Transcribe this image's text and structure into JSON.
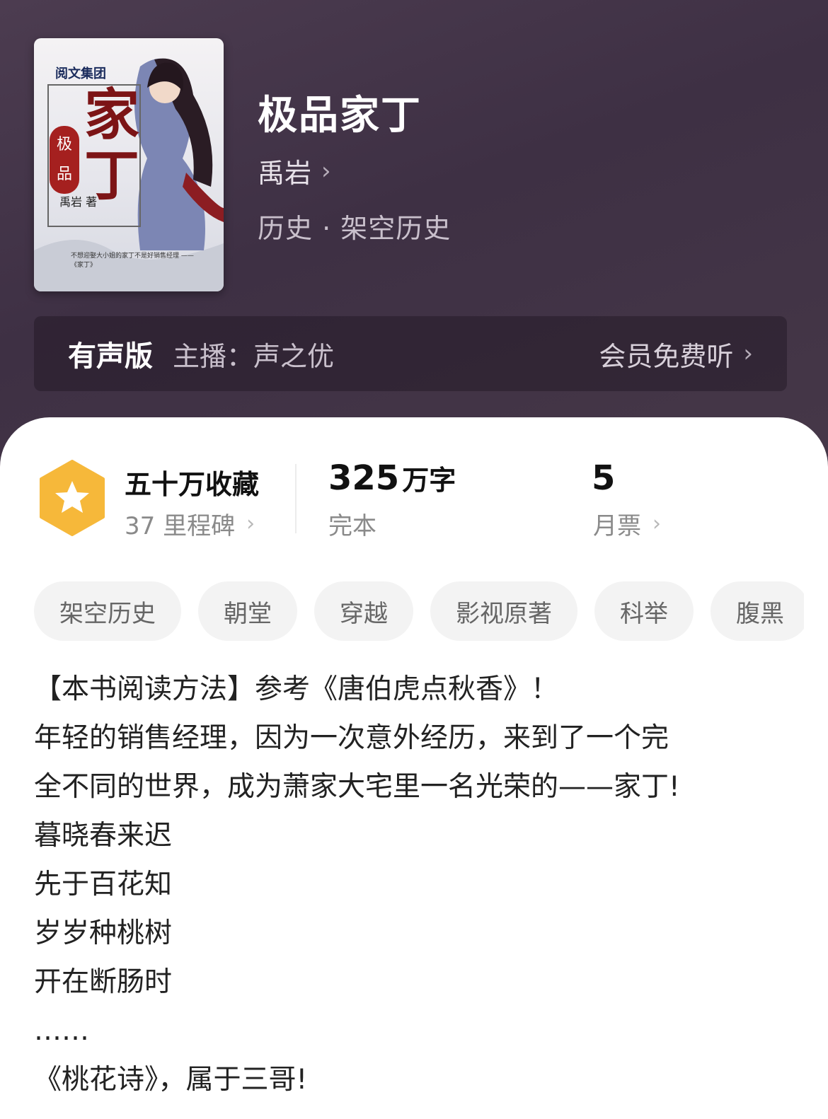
{
  "book": {
    "title": "极品家丁",
    "author": "禹岩",
    "category": "历史 · 架空历史",
    "cover": {
      "publisher": "阅文集团",
      "title": "家丁",
      "badge": "极品",
      "author": "禹岩 著",
      "tagline": "不想迎娶大小姐的家丁不是好销售经理 ——《家丁》"
    }
  },
  "audio": {
    "label": "有声版",
    "host": "主播：声之优",
    "cta": "会员免费听"
  },
  "stats": {
    "collect_main": "五十万收藏",
    "collect_sub": "37 里程碑",
    "words_num": "325",
    "words_unit": "万字",
    "status": "完本",
    "tickets_num": "5",
    "tickets_label": "月票"
  },
  "tags": [
    "架空历史",
    "朝堂",
    "穿越",
    "影视原著",
    "科举",
    "腹黑"
  ],
  "description": [
    "【本书阅读方法】参考《唐伯虎点秋香》！",
    "年轻的销售经理，因为一次意外经历，来到了一个完",
    "全不同的世界，成为萧家大宅里一名光荣的——家丁!",
    "暮晓春来迟",
    "先于百花知",
    "岁岁种桃树",
    "开在断肠时",
    "……",
    "《桃花诗》，属于三哥!"
  ],
  "colors": {
    "header_bg": "#3e3044",
    "badge_gold": "#f6b83a"
  }
}
